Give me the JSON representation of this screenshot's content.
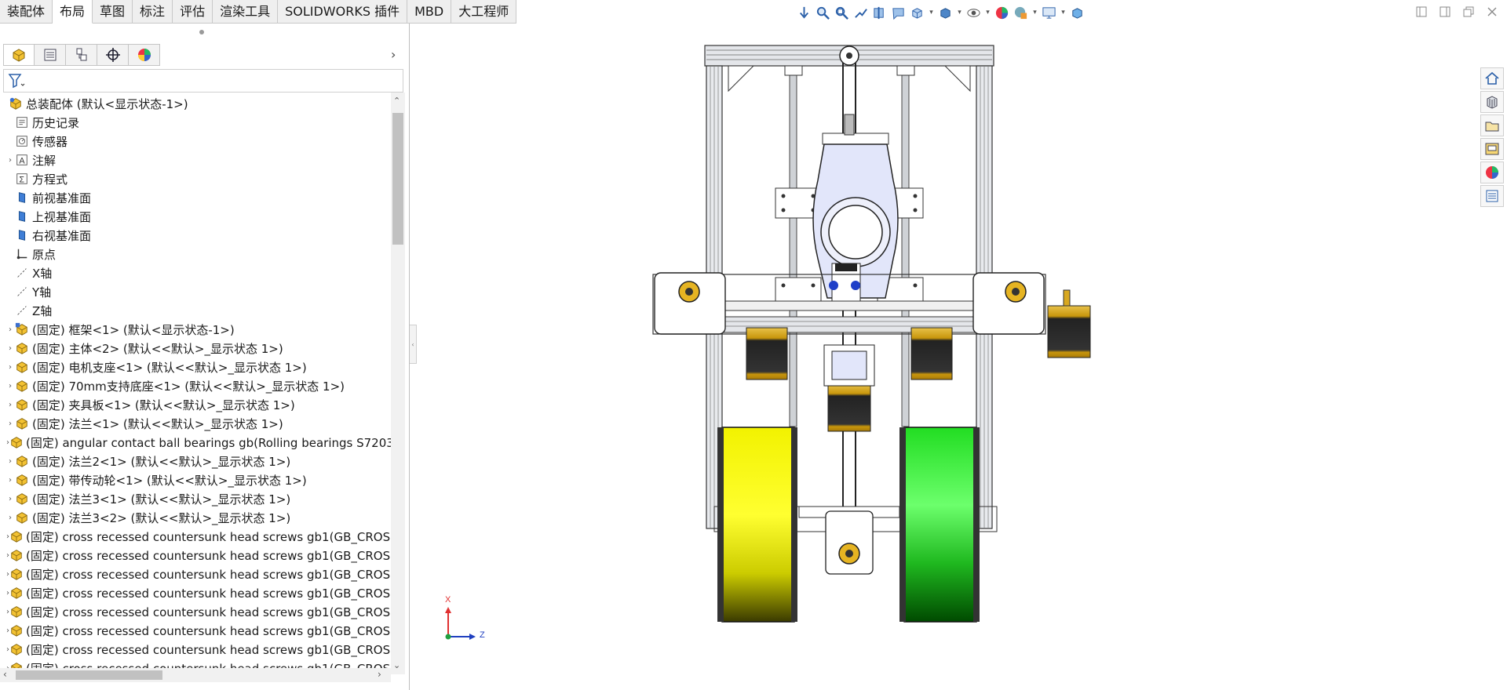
{
  "command_manager": {
    "tabs": [
      "装配体",
      "布局",
      "草图",
      "标注",
      "评估",
      "渲染工具",
      "SOLIDWORKS 插件",
      "MBD",
      "大工程师"
    ],
    "active_tab_index": 1
  },
  "heads_up_toolbar": {
    "icons": [
      "view-orientation-icon",
      "zoom-to-fit-icon",
      "zoom-to-area-icon",
      "previous-view-icon",
      "section-view-icon",
      "dynamic-annotation-icon",
      "view-orientation-box-icon",
      "display-style-icon",
      "hide-show-items-icon",
      "edit-appearance-icon",
      "apply-scene-icon",
      "view-settings-icon",
      "3d-view-icon"
    ]
  },
  "window_controls": [
    "tile-left-icon",
    "tile-right-icon",
    "restore-icon",
    "close-icon"
  ],
  "panel_tabs": [
    "featuremanager-tab",
    "propertymanager-tab",
    "configurationmanager-tab",
    "dimxpertmanager-tab",
    "displaymanager-tab"
  ],
  "feature_tree": {
    "root": "总装配体  (默认<显示状态-1>)",
    "items": [
      {
        "label": "历史记录",
        "icon": "history-icon",
        "expandable": false
      },
      {
        "label": "传感器",
        "icon": "sensor-icon",
        "expandable": false
      },
      {
        "label": "注解",
        "icon": "annotation-icon",
        "expandable": true
      },
      {
        "label": "方程式",
        "icon": "equation-icon",
        "expandable": false
      },
      {
        "label": "前视基准面",
        "icon": "plane-icon",
        "expandable": false
      },
      {
        "label": "上视基准面",
        "icon": "plane-icon",
        "expandable": false
      },
      {
        "label": "右视基准面",
        "icon": "plane-icon",
        "expandable": false
      },
      {
        "label": "原点",
        "icon": "origin-icon",
        "expandable": false
      },
      {
        "label": "X轴",
        "icon": "axis-icon",
        "expandable": false
      },
      {
        "label": "Y轴",
        "icon": "axis-icon",
        "expandable": false
      },
      {
        "label": "Z轴",
        "icon": "axis-icon",
        "expandable": false
      },
      {
        "label": "(固定) 框架<1> (默认<显示状态-1>)",
        "icon": "subassembly-icon",
        "expandable": true
      },
      {
        "label": "(固定) 主体<2> (默认<<默认>_显示状态 1>)",
        "icon": "part-icon",
        "expandable": true
      },
      {
        "label": "(固定) 电机支座<1> (默认<<默认>_显示状态 1>)",
        "icon": "part-icon",
        "expandable": true
      },
      {
        "label": "(固定) 70mm支持底座<1> (默认<<默认>_显示状态 1>)",
        "icon": "part-icon",
        "expandable": true
      },
      {
        "label": "(固定) 夹具板<1> (默认<<默认>_显示状态 1>)",
        "icon": "part-icon",
        "expandable": true
      },
      {
        "label": "(固定) 法兰<1> (默认<<默认>_显示状态 1>)",
        "icon": "part-icon",
        "expandable": true
      },
      {
        "label": "(固定) angular contact ball bearings gb(Rolling bearings S7203",
        "icon": "part-icon",
        "expandable": true
      },
      {
        "label": "(固定) 法兰2<1> (默认<<默认>_显示状态 1>)",
        "icon": "part-icon",
        "expandable": true
      },
      {
        "label": "(固定) 带传动轮<1> (默认<<默认>_显示状态 1>)",
        "icon": "part-icon",
        "expandable": true
      },
      {
        "label": "(固定) 法兰3<1> (默认<<默认>_显示状态 1>)",
        "icon": "part-icon",
        "expandable": true
      },
      {
        "label": "(固定) 法兰3<2> (默认<<默认>_显示状态 1>)",
        "icon": "part-icon",
        "expandable": true
      },
      {
        "label": "(固定) cross recessed countersunk head screws gb1(GB_CROSS",
        "icon": "part-icon",
        "expandable": true
      },
      {
        "label": "(固定) cross recessed countersunk head screws gb1(GB_CROSS",
        "icon": "part-icon",
        "expandable": true
      },
      {
        "label": "(固定) cross recessed countersunk head screws gb1(GB_CROSS",
        "icon": "part-icon",
        "expandable": true
      },
      {
        "label": "(固定) cross recessed countersunk head screws gb1(GB_CROSS",
        "icon": "part-icon",
        "expandable": true
      },
      {
        "label": "(固定) cross recessed countersunk head screws gb1(GB_CROSS",
        "icon": "part-icon",
        "expandable": true
      },
      {
        "label": "(固定) cross recessed countersunk head screws gb1(GB_CROSS",
        "icon": "part-icon",
        "expandable": true
      },
      {
        "label": "(固定) cross recessed countersunk head screws gb1(GB_CROSS",
        "icon": "part-icon",
        "expandable": true
      },
      {
        "label": "(固定) cross recessed countersunk head screws gb1(GB_CROSS",
        "icon": "part-icon",
        "expandable": true
      }
    ]
  },
  "triad": {
    "x_label": "X",
    "z_label": "Z"
  },
  "task_pane": [
    "home-icon",
    "design-library-icon",
    "file-explorer-icon",
    "view-palette-icon",
    "appearances-icon",
    "custom-properties-icon"
  ],
  "colors": {
    "wheel_left": "#f2f200",
    "wheel_right": "#22dd22",
    "motor_body": "#c8960c",
    "frame": "#9aa0a8"
  }
}
